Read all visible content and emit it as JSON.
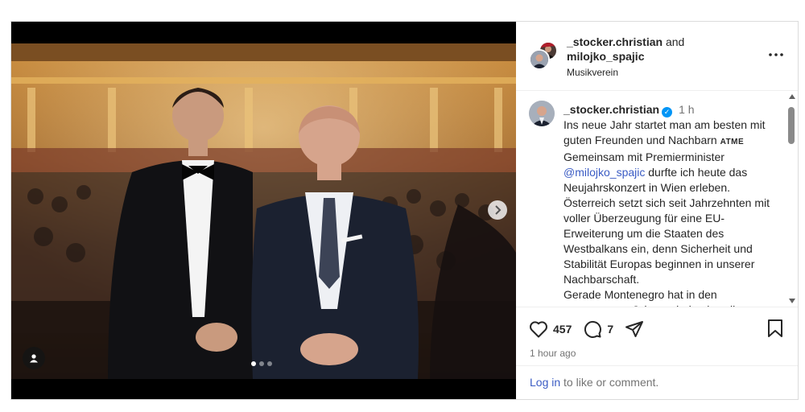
{
  "header": {
    "user1": "_stocker.christian",
    "connector": "and",
    "user2": "milojko_spajic",
    "location": "Musikverein",
    "more_icon": "more-horizontal-icon"
  },
  "caption": {
    "username": "_stocker.christian",
    "time": "1 h",
    "lines": {
      "l1": "Ins neue Jahr startet man am besten mit guten Freunden und Nachbarn ",
      "atme": "ATME",
      "l2": "Gemeinsam mit Premierminister ",
      "mention": "@milojko_spajic",
      "l3": " durfte ich heute das Neujahrskonzert in Wien erleben.",
      "l4": "Österreich setzt sich seit Jahrzehnten mit voller Überzeugung für eine EU-Erweiterung um die Staaten des Westbalkans ein, denn Sicherheit und Stabilität Europas beginnen in unserer Nachbarschaft.",
      "l5": "Gerade Montenegro hat in den vergangenen Jahren eindrucksvoll"
    }
  },
  "actions": {
    "likes": "457",
    "comments": "7",
    "timestamp": "1 hour ago"
  },
  "footer": {
    "login": "Log in",
    "rest": " to like or comment."
  },
  "colors": {
    "link": "#3b5cc4",
    "verified": "#0095f6",
    "muted": "#737373"
  }
}
